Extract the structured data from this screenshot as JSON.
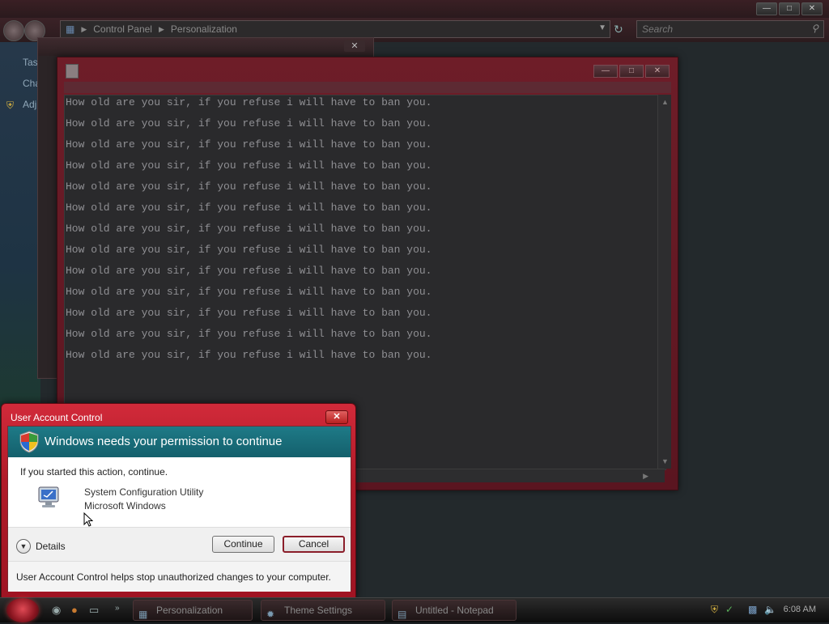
{
  "explorer": {
    "breadcrumb": [
      "Control Panel",
      "Personalization"
    ],
    "search_placeholder": "Search",
    "left_pane": [
      "Tas",
      "Cha",
      "Adj"
    ]
  },
  "notepad": {
    "lines": [
      "How old are you sir, if you refuse i will have to ban you.",
      "How old are you sir, if you refuse i will have to ban you.",
      "How old are you sir, if you refuse i will have to ban you.",
      "How old are you sir, if you refuse i will have to ban you.",
      "How old are you sir, if you refuse i will have to ban you.",
      "How old are you sir, if you refuse i will have to ban you.",
      "How old are you sir, if you refuse i will have to ban you.",
      "How old are you sir, if you refuse i will have to ban you.",
      "How old are you sir, if you refuse i will have to ban you.",
      "How old are you sir, if you refuse i will have to ban you.",
      "How old are you sir, if you refuse i will have to ban you.",
      "How old are you sir, if you refuse i will have to ban you.",
      "How old are you sir, if you refuse i will have to ban you."
    ]
  },
  "uac": {
    "title": "User Account Control",
    "banner": "Windows needs your permission to continue",
    "message": "If you started this action, continue.",
    "program_name": "System Configuration Utility",
    "publisher": "Microsoft Windows",
    "details_label": "Details",
    "continue_label": "Continue",
    "cancel_label": "Cancel",
    "footer": "User Account Control helps stop unauthorized changes to your computer."
  },
  "taskbar": {
    "tasks": [
      "Personalization",
      "Theme Settings",
      "Untitled - Notepad"
    ],
    "clock": "6:08 AM"
  },
  "colors": {
    "uac_frame": "#b01a28",
    "uac_banner": "#1e7a87",
    "notepad_frame": "#6e1d28"
  },
  "icons": {
    "uac_shield": "shield-icon",
    "program": "computer-icon",
    "details": "chevron-down-icon"
  }
}
